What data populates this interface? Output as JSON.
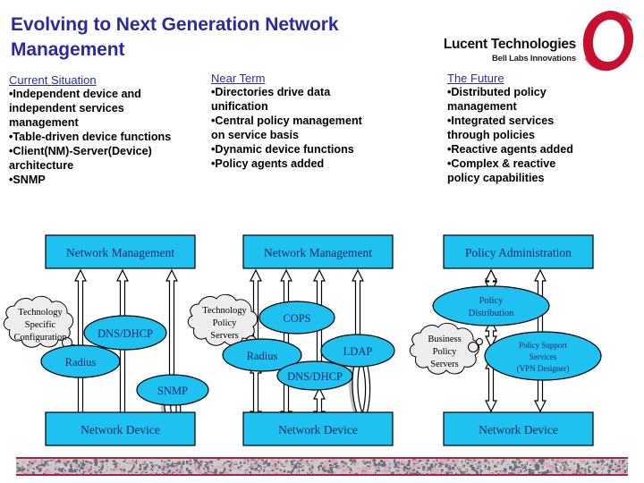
{
  "slide": {
    "title": "Evolving to Next Generation Network Management",
    "title_line1": "Evolving to Next Generation Network",
    "title_line2": "Management",
    "title_color": "#2B2BA0",
    "background": "#FFFFFF"
  },
  "logo": {
    "name": "Lucent Technologies",
    "tagline": "Bell Labs Innovations",
    "mark": "lucent-red-circle-brushstroke",
    "mark_color": "#C8102E"
  },
  "columns": [
    {
      "heading": "Current Situation",
      "lines": [
        "•Independent device and",
        "independent services",
        "management",
        "•Table-driven device functions",
        "•Client(NM)-Server(Device)",
        " architecture",
        "•SNMP"
      ]
    },
    {
      "heading": "Near Term",
      "lines": [
        " •Directories drive data",
        "unification",
        " •Central policy management",
        "on service basis",
        " •Dynamic device functions",
        " •Policy agents added"
      ]
    },
    {
      "heading": "The Future",
      "lines": [
        "•Distributed policy",
        "management",
        "•Integrated services",
        "through policies",
        "•Reactive agents added",
        "•Complex & reactive",
        "policy capabilities"
      ]
    }
  ],
  "diagram": {
    "fill_cyan": "#1EC1F0",
    "text_navy": "#1B2A6B",
    "cloud_fill": "#EDEDED",
    "panels": [
      {
        "id": "panel-current",
        "top_box": "Network Management",
        "bottom_box": "Network Device",
        "cloud": [
          "Technology",
          "Specific",
          "Configuration"
        ],
        "ellipses": [
          "DNS/DHCP",
          "Radius",
          "SNMP"
        ]
      },
      {
        "id": "panel-near-term",
        "top_box": "Network Management",
        "bottom_box": "Network Device",
        "cloud": [
          "Technology",
          "Policy",
          "Servers"
        ],
        "ellipses": [
          "COPS",
          "Radius",
          "DNS/DHCP",
          "LDAP"
        ]
      },
      {
        "id": "panel-future",
        "top_box": "Policy Administration",
        "bottom_box": "Network Device",
        "cloud": [
          "Business",
          "Policy",
          "Servers"
        ],
        "ellipses": [
          "Policy Distribution",
          "Policy Support Services (VPN Designer)"
        ],
        "ellipse_lines": {
          "policy_distribution": [
            "Policy",
            "Distribution"
          ],
          "policy_support": [
            "Policy Support",
            "Services",
            "(VPN Designer)"
          ]
        }
      }
    ]
  },
  "footer": {
    "strip_border_color": "#A8234A",
    "strip_fill_color": "#C9C9C9",
    "strip_name": "decorative-texture-strip"
  }
}
